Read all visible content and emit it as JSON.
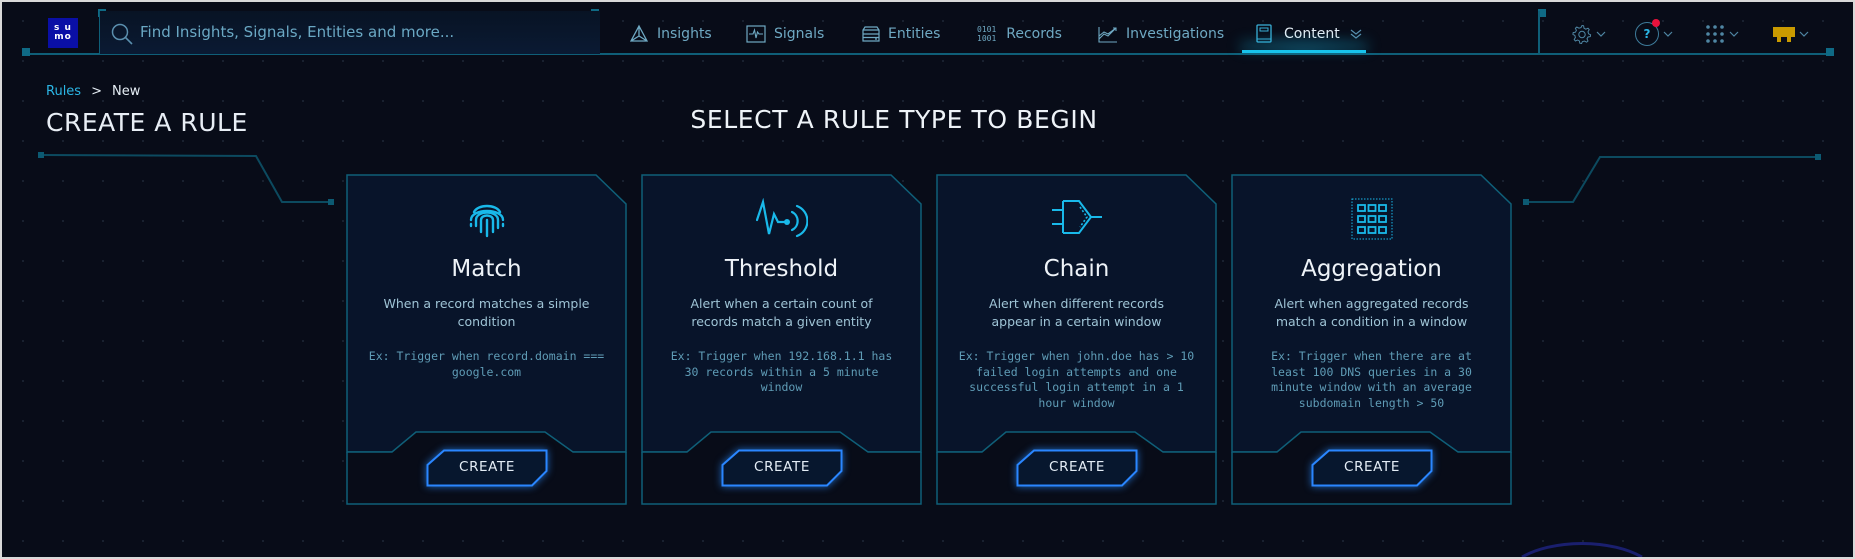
{
  "header": {
    "logo_top": "s u",
    "logo_bottom": "mo",
    "search_placeholder": "Find Insights, Signals, Entities and more...",
    "nav": [
      {
        "label": "Insights",
        "icon": "insights-icon"
      },
      {
        "label": "Signals",
        "icon": "signals-icon"
      },
      {
        "label": "Entities",
        "icon": "entities-icon"
      },
      {
        "label": "Records",
        "icon": "records-icon",
        "glyph_top": "0101",
        "glyph_bottom": "1001"
      },
      {
        "label": "Investigations",
        "icon": "investigations-icon"
      },
      {
        "label": "Content",
        "icon": "content-icon",
        "active": true
      }
    ],
    "utilities": [
      "settings",
      "help",
      "apps",
      "user"
    ],
    "help_glyph": "?",
    "colors": {
      "accent": "#18c3ec",
      "notification": "#e8123c",
      "user": "#c99a00",
      "logo": "#0a0fa6"
    }
  },
  "breadcrumb": {
    "parent": "Rules",
    "separator": ">",
    "current": "New"
  },
  "page_title": "CREATE A RULE",
  "section_title": "SELECT A RULE TYPE TO BEGIN",
  "cards": [
    {
      "title": "Match",
      "icon": "fingerprint-icon",
      "description": "When a record matches a simple condition",
      "example": "Ex: Trigger when record.domain === google.com",
      "button": "CREATE"
    },
    {
      "title": "Threshold",
      "icon": "threshold-pulse-icon",
      "description": "Alert when a certain count of records match a given entity",
      "example": "Ex: Trigger when 192.168.1.1 has 30 records within a 5 minute window",
      "button": "CREATE"
    },
    {
      "title": "Chain",
      "icon": "chain-gate-icon",
      "description": "Alert when different records appear in a certain window",
      "example": "Ex: Trigger when john.doe has > 10 failed login attempts and one successful login attempt in a 1 hour window",
      "button": "CREATE"
    },
    {
      "title": "Aggregation",
      "icon": "aggregation-grid-icon",
      "description": "Alert when aggregated records match a condition in a window",
      "example": "Ex: Trigger when there are at least 100 DNS queries in a 30 minute window with an average subdomain length > 50",
      "button": "CREATE"
    }
  ]
}
